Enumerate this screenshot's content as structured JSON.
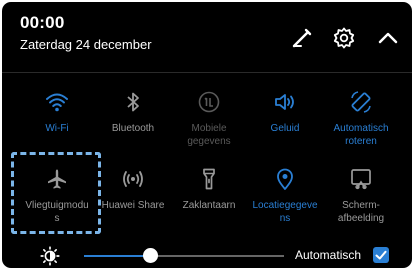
{
  "header": {
    "time": "00:00",
    "date": "Zaterdag 24 december",
    "icons": [
      "edit-icon",
      "gear-icon",
      "chevron-up-icon"
    ]
  },
  "tiles": [
    {
      "label": "Wi-Fi",
      "icon": "wifi-icon",
      "state": "on"
    },
    {
      "label": "Bluetooth",
      "icon": "bluetooth-icon",
      "state": "off"
    },
    {
      "label": "Mobiele\ngegevens",
      "icon": "mobile-data-icon",
      "state": "dim"
    },
    {
      "label": "Geluid",
      "icon": "sound-icon",
      "state": "on"
    },
    {
      "label": "Automatisch\nroteren",
      "icon": "auto-rotate-icon",
      "state": "on"
    },
    {
      "label": "Vliegtuigmodu\ns",
      "icon": "airplane-icon",
      "state": "off"
    },
    {
      "label": "Huawei Share",
      "icon": "huawei-share-icon",
      "state": "off"
    },
    {
      "label": "Zaklantaarn",
      "icon": "flashlight-icon",
      "state": "off"
    },
    {
      "label": "Locatiegegeve\nns",
      "icon": "location-icon",
      "state": "on"
    },
    {
      "label": "Scherm-\nafbeelding",
      "icon": "screenshot-icon",
      "state": "off"
    }
  ],
  "brightness": {
    "level": 0.3,
    "auto_label": "Automatisch",
    "auto_checked": true
  },
  "colors": {
    "accent": "#2a7fd4",
    "background": "#000000",
    "inactive": "#9a9a9a"
  }
}
